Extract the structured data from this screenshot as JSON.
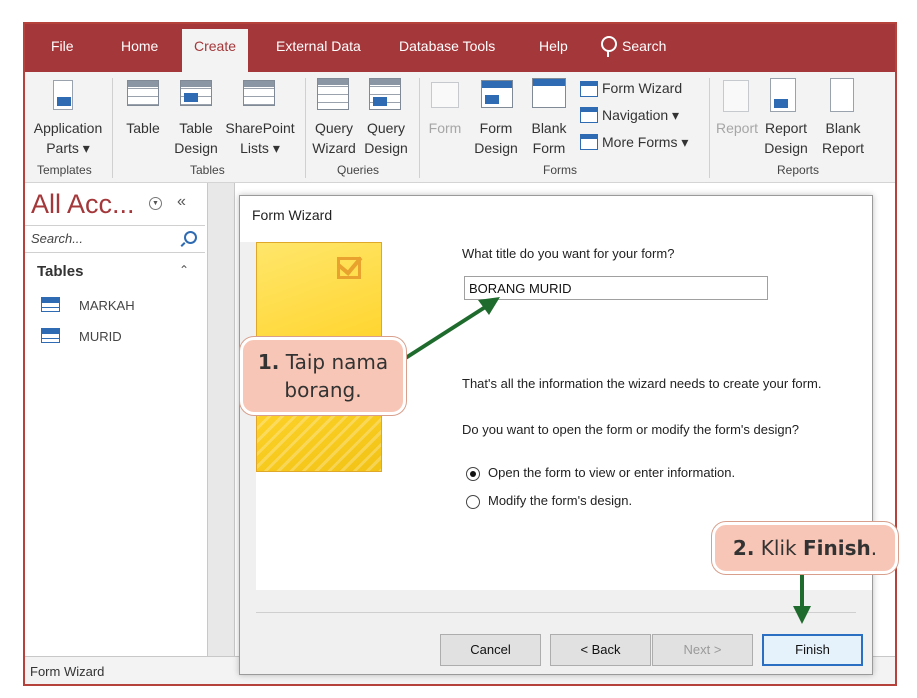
{
  "tabs": [
    "File",
    "Home",
    "Create",
    "External Data",
    "Database Tools",
    "Help"
  ],
  "active_tab": "Create",
  "tell_me": "Search",
  "ribbon": {
    "templates": {
      "label": "Templates",
      "application_parts": "Application",
      "application_parts_2": "Parts ▾"
    },
    "tables": {
      "label": "Tables",
      "table": "Table",
      "table_design": "Table",
      "table_design_2": "Design",
      "sharepoint": "SharePoint",
      "sharepoint_2": "Lists ▾"
    },
    "queries": {
      "label": "Queries",
      "query_wizard": "Query",
      "query_wizard_2": "Wizard",
      "query_design": "Query",
      "query_design_2": "Design"
    },
    "forms": {
      "label": "Forms",
      "form": "Form",
      "form_design": "Form",
      "form_design_2": "Design",
      "blank_form": "Blank",
      "blank_form_2": "Form",
      "form_wizard": "Form Wizard",
      "navigation": "Navigation ▾",
      "more_forms": "More Forms ▾"
    },
    "reports": {
      "label": "Reports",
      "report": "Report",
      "report_design": "Report",
      "report_design_2": "Design",
      "blank_report": "Blank",
      "blank_report_2": "Report"
    }
  },
  "nav": {
    "title": "All Acc...",
    "collapse": "«",
    "search_placeholder": "Search...",
    "section": "Tables",
    "section_toggle": "⌃",
    "items": [
      "MARKAH",
      "MURID"
    ]
  },
  "status": "Form Wizard",
  "dialog": {
    "title": "Form Wizard",
    "question1": "What title do you want for your form?",
    "title_value": "BORANG MURID",
    "info": "That's all the information the wizard needs to create your form.",
    "question2": "Do you want to open the form or modify the form's design?",
    "option_open": "Open the form to view or enter information.",
    "option_modify": "Modify the form's design.",
    "selected_option": "open",
    "buttons": {
      "cancel": "Cancel",
      "back": "< Back",
      "next": "Next >",
      "finish": "Finish"
    }
  },
  "callouts": {
    "step1_num": "1.",
    "step1_text_a": "Taip nama",
    "step1_text_b": "borang.",
    "step2_num": "2.",
    "step2_text": "Klik",
    "step2_bold": "Finish"
  },
  "colors": {
    "accent": "#a4373a",
    "callout": "#f7c6b6",
    "arrow": "#1f6b2e",
    "focus": "#2b6fc2"
  }
}
